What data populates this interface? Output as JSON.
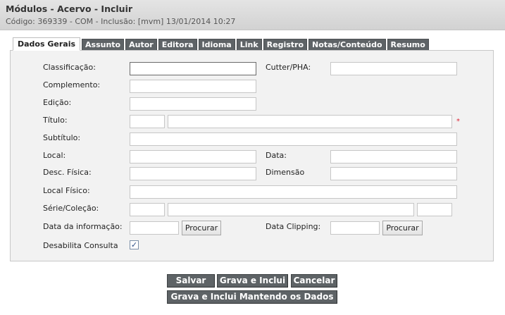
{
  "header": {
    "title": "Módulos - Acervo - Incluir",
    "subtitle": "Código: 369339 - COM - Inclusão: [mvm] 13/01/2014 10:27"
  },
  "tabs": [
    {
      "label": "Dados Gerais",
      "active": true
    },
    {
      "label": "Assunto"
    },
    {
      "label": "Autor"
    },
    {
      "label": "Editora"
    },
    {
      "label": "Idioma"
    },
    {
      "label": "Link"
    },
    {
      "label": "Registro"
    },
    {
      "label": "Notas/Conteúdo"
    },
    {
      "label": "Resumo"
    }
  ],
  "form": {
    "classificacao": "Classificação:",
    "cutter": "Cutter/PHA:",
    "complemento": "Complemento:",
    "edicao": "Edição:",
    "titulo": "Título:",
    "required_mark": "*",
    "subtitulo": "Subtítulo:",
    "local": "Local:",
    "data": "Data:",
    "desc_fisica": "Desc. Física:",
    "dimensao": "Dimensão",
    "local_fisico": "Local Físico:",
    "serie": "Série/Coleção:",
    "data_informacao": "Data da informação:",
    "data_clipping": "Data Clipping:",
    "procurar": "Procurar",
    "desabilita": "Desabilita Consulta",
    "desabilita_checked": true,
    "check_mark": "✓"
  },
  "actions": {
    "salvar": "Salvar",
    "grava_inclui": "Grava e Inclui",
    "cancelar": "Cancelar",
    "grava_mantendo": "Grava e Inclui Mantendo os Dados"
  }
}
